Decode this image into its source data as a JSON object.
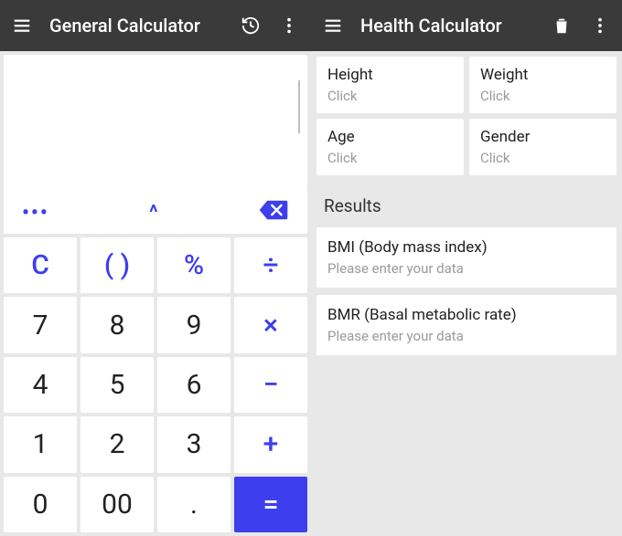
{
  "left": {
    "title": "General Calculator",
    "fn": {
      "more": "•••",
      "caret": "^"
    },
    "keys": {
      "clear": "C",
      "paren": "( )",
      "percent": "%",
      "div": "÷",
      "k7": "7",
      "k8": "8",
      "k9": "9",
      "mul": "×",
      "k4": "4",
      "k5": "5",
      "k6": "6",
      "sub": "−",
      "k1": "1",
      "k2": "2",
      "k3": "3",
      "add": "+",
      "k0": "0",
      "k00": "00",
      "dot": ".",
      "eq": "="
    }
  },
  "right": {
    "title": "Health Calculator",
    "inputs": [
      {
        "label": "Height",
        "hint": "Click"
      },
      {
        "label": "Weight",
        "hint": "Click"
      },
      {
        "label": "Age",
        "hint": "Click"
      },
      {
        "label": "Gender",
        "hint": "Click"
      }
    ],
    "resultsHeader": "Results",
    "results": [
      {
        "label": "BMI (Body mass index)",
        "hint": "Please enter your data"
      },
      {
        "label": "BMR (Basal metabolic rate)",
        "hint": "Please enter your data"
      }
    ]
  }
}
